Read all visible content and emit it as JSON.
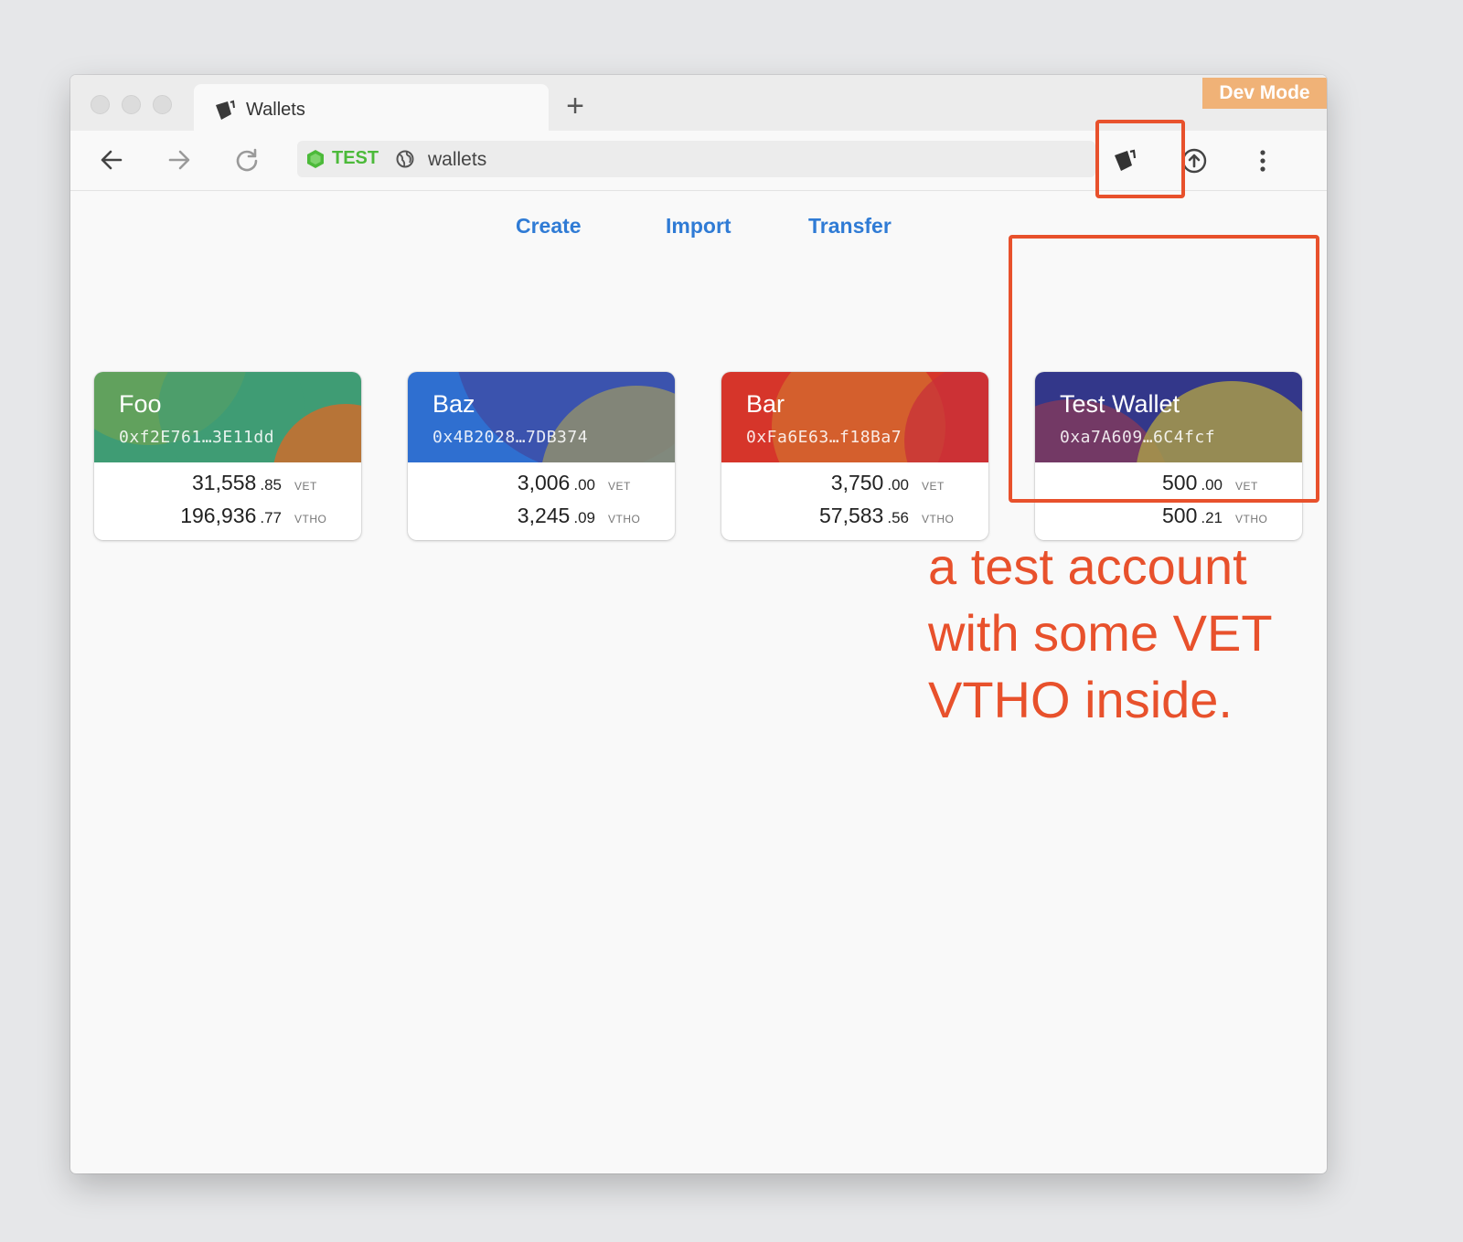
{
  "browser": {
    "tab_title": "Wallets",
    "new_tab_symbol": "+",
    "dev_mode_badge": "Dev Mode",
    "network_label": "TEST",
    "network_color": "#4cba3a",
    "url": "wallets",
    "extension_icon": "wallet-icon",
    "toolbar_icons": [
      "back-arrow-icon",
      "forward-arrow-icon",
      "reload-icon",
      "upload-icon",
      "more-vert-icon"
    ]
  },
  "actions": {
    "create": "Create",
    "import": "Import",
    "transfer": "Transfer"
  },
  "wallets": [
    {
      "name": "Foo",
      "address": "0xf2E761…3E11dd",
      "vet_int": "31,558",
      "vet_dec": ".85",
      "vet_unit": "VET",
      "vtho_int": "196,936",
      "vtho_dec": ".77",
      "vtho_unit": "VTHO",
      "palette": [
        "#3f9c74",
        "#7ea64a",
        "#d66a28"
      ]
    },
    {
      "name": "Baz",
      "address": "0x4B2028…7DB374",
      "vet_int": "3,006",
      "vet_dec": ".00",
      "vet_unit": "VET",
      "vtho_int": "3,245",
      "vtho_dec": ".09",
      "vtho_unit": "VTHO",
      "palette": [
        "#2f6fd0",
        "#3d4fa8",
        "#8f8e6e"
      ]
    },
    {
      "name": "Bar",
      "address": "0xFa6E63…f18Ba7",
      "vet_int": "3,750",
      "vet_dec": ".00",
      "vet_unit": "VET",
      "vtho_int": "57,583",
      "vtho_dec": ".56",
      "vtho_unit": "VTHO",
      "palette": [
        "#d6352a",
        "#d4642e",
        "#c8303a"
      ]
    },
    {
      "name": "Test Wallet",
      "address": "0xa7A609…6C4fcf",
      "vet_int": "500",
      "vet_dec": ".00",
      "vet_unit": "VET",
      "vtho_int": "500",
      "vtho_dec": ".21",
      "vtho_unit": "VTHO",
      "palette": [
        "#33378a",
        "#7a3a60",
        "#a89a4a"
      ]
    }
  ],
  "annotation": {
    "text": "a test account with some VET VTHO inside.",
    "color": "#e8512c"
  }
}
